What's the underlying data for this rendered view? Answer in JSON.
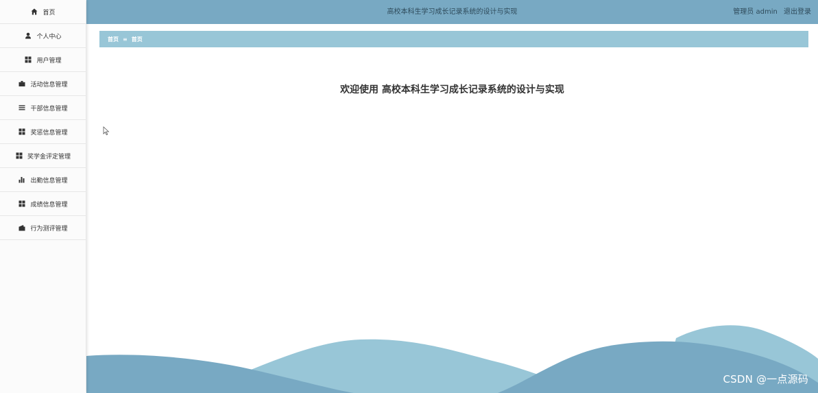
{
  "sidebar": {
    "items": [
      {
        "label": "首页",
        "icon": "home-icon"
      },
      {
        "label": "个人中心",
        "icon": "user-icon"
      },
      {
        "label": "用户管理",
        "icon": "grid-icon"
      },
      {
        "label": "活动信息管理",
        "icon": "briefcase-icon"
      },
      {
        "label": "干部信息管理",
        "icon": "list-icon"
      },
      {
        "label": "奖惩信息管理",
        "icon": "grid-icon"
      },
      {
        "label": "奖学金评定管理",
        "icon": "grid-icon"
      },
      {
        "label": "出勤信息管理",
        "icon": "bar-chart-icon"
      },
      {
        "label": "成绩信息管理",
        "icon": "grid-icon"
      },
      {
        "label": "行为测评管理",
        "icon": "wallet-icon"
      }
    ]
  },
  "header": {
    "title": "高校本科生学习成长记录系统的设计与实现",
    "user": "管理员 admin",
    "logout": "退出登录"
  },
  "breadcrumb": {
    "home": "首页",
    "separator": "≡",
    "current": "首页"
  },
  "main": {
    "welcome": "欢迎使用 高校本科生学习成长记录系统的设计与实现"
  },
  "watermark": "CSDN @一点源码",
  "colors": {
    "header_bg": "#78a9c3",
    "breadcrumb_bg": "#98c6d7",
    "wave_light": "#98c6d7",
    "wave_dark": "#78a9c3"
  }
}
